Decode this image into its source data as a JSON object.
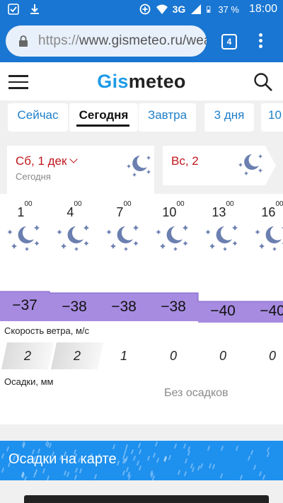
{
  "status_bar": {
    "signal": "3G",
    "battery": "37 %",
    "time": "18:00"
  },
  "browser": {
    "url_scheme": "https://",
    "url_rest": "www.gismeteo.ru/wea",
    "tab_count": "4"
  },
  "site": {
    "logo_part1": "Gis",
    "logo_part2": "meteo"
  },
  "day_tabs": [
    {
      "label": "Сейчас"
    },
    {
      "label": "Сегодня"
    },
    {
      "label": "Завтра"
    },
    {
      "label": "3 дня"
    },
    {
      "label": "10"
    }
  ],
  "date_cards": [
    {
      "label": "Сб, 1 дек",
      "sub": "Сегодня"
    },
    {
      "label": "Вс, 2",
      "sub": ""
    }
  ],
  "hours": [
    {
      "h": "1",
      "m": "00"
    },
    {
      "h": "4",
      "m": "00"
    },
    {
      "h": "7",
      "m": "00"
    },
    {
      "h": "10",
      "m": "00"
    },
    {
      "h": "13",
      "m": "00"
    },
    {
      "h": "16",
      "m": "00"
    }
  ],
  "temperatures": [
    "−37",
    "−38",
    "−38",
    "−38",
    "−40",
    "−40"
  ],
  "wind": {
    "label": "Скорость ветра, м/с",
    "values": [
      "2",
      "2",
      "1",
      "0",
      "0",
      "0"
    ]
  },
  "precip": {
    "label": "Осадки, мм",
    "text": "Без осадков"
  },
  "map_banner": {
    "title": "Осадки на карте"
  },
  "colors": {
    "brand_blue": "#1976d2",
    "accent_blue": "#1e9be8",
    "temp_band": "#a78be0",
    "date_red": "#c0161c",
    "moon": "#6b7fb0"
  }
}
